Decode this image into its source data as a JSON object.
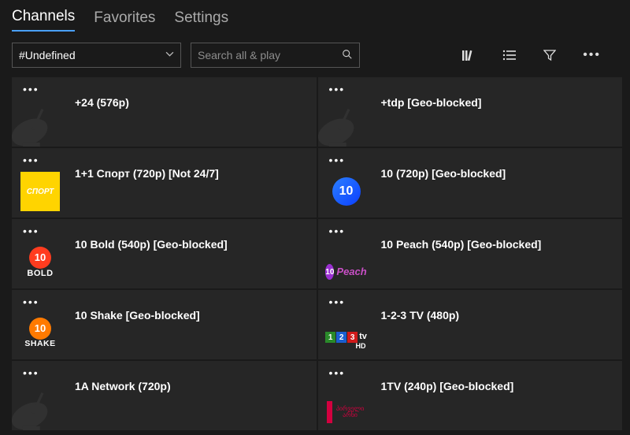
{
  "tabs": {
    "channels": "Channels",
    "favorites": "Favorites",
    "settings": "Settings"
  },
  "filter": {
    "selected": "#Undefined"
  },
  "search": {
    "placeholder": "Search all & play"
  },
  "channels": [
    {
      "title": "+24 (576p)",
      "logo": "dish"
    },
    {
      "title": "+tdp [Geo-blocked]",
      "logo": "dish"
    },
    {
      "title": "1+1 Спорт (720p) [Not 24/7]",
      "logo": "sport"
    },
    {
      "title": "10 (720p) [Geo-blocked]",
      "logo": "ten"
    },
    {
      "title": "10 Bold (540p) [Geo-blocked]",
      "logo": "bold"
    },
    {
      "title": "10 Peach (540p) [Geo-blocked]",
      "logo": "peach"
    },
    {
      "title": "10 Shake [Geo-blocked]",
      "logo": "shake"
    },
    {
      "title": "1-2-3 TV (480p)",
      "logo": "ott123"
    },
    {
      "title": "1A Network (720p)",
      "logo": "dish"
    },
    {
      "title": "1TV (240p) [Geo-blocked]",
      "logo": "onetv"
    }
  ],
  "logo_text": {
    "sport": "СПОРТ",
    "ten": "10",
    "bold_num": "10",
    "bold_txt": "BOLD",
    "peach_num": "10",
    "peach_txt": "Peach",
    "shake_num": "10",
    "shake_txt": "SHAKE",
    "ott_tv": "tv",
    "ott_hd": "HD",
    "onetv_txt": "პირველი არხი"
  }
}
